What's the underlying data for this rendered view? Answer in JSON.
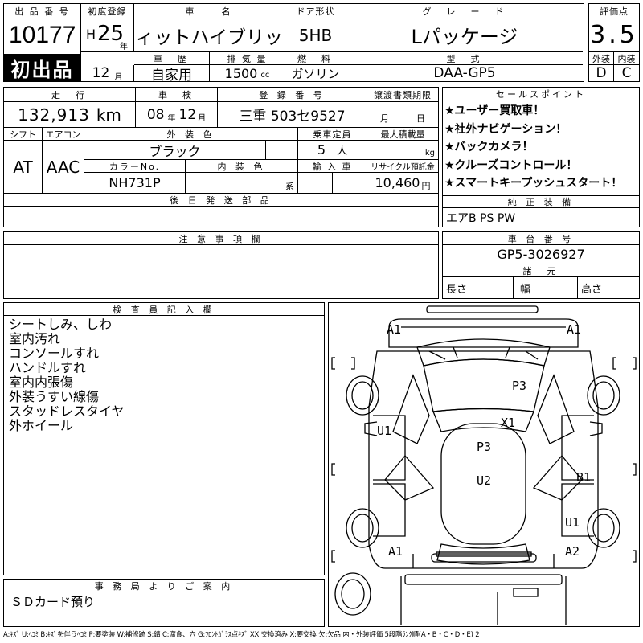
{
  "header": {
    "lot_no_label": "出 品 番 号",
    "lot_no": "10177",
    "first_listing": "初出品",
    "first_reg_label": "初度登録",
    "era": "H",
    "year": "25",
    "year_unit": "年",
    "month": "12",
    "month_unit": "月",
    "car_name_label": "車　　名",
    "car_name": "フィットハイブリッド",
    "door_label": "ドア形状",
    "door": "5HB",
    "grade_label": "グ　レ　ー　ド",
    "grade": "Lパッケージ",
    "score_label": "評価点",
    "score": "3.5",
    "history_label": "車　歴",
    "history": "自家用",
    "displacement_label": "排 気 量",
    "displacement": "1500",
    "displacement_unit": "cc",
    "fuel_label": "燃　料",
    "fuel": "ガソリン",
    "model_label": "型　式",
    "model": "DAA-GP5",
    "exterior_label": "外装",
    "exterior": "D",
    "interior_label": "内装",
    "interior": "C"
  },
  "row2": {
    "mileage_label": "走　行",
    "mileage": "132,913",
    "mileage_unit": "km",
    "inspection_label": "車　検",
    "inspection_year": "08",
    "inspection_month": "12",
    "plate_label": "登 録 番 号",
    "plate": "三重 503セ9527",
    "transfer_label": "譲渡書類期限",
    "transfer_month": "月",
    "transfer_day": "日",
    "shift_label": "シフト",
    "shift": "AT",
    "ac_label": "エアコン",
    "ac": "AAC",
    "ext_color_label": "外 装 色",
    "ext_color": "ブラック",
    "capacity_label": "乗車定員",
    "capacity": "5",
    "capacity_unit": "人",
    "load_label": "最大積載量",
    "load_unit": "kg",
    "color_no_label": "カラーNo.",
    "color_no": "NH731P",
    "int_color_label": "内 装 色",
    "int_color_unit": "系",
    "import_label": "輸 入 車",
    "recycle_label": "リサイクル預託金",
    "recycle": "10,460",
    "recycle_unit": "円",
    "later_parts_label": "後 日 発 送 部 品"
  },
  "sales": {
    "label": "セールスポイント",
    "points": [
      "★ユーザー買取車！",
      "★社外ナビゲーション！",
      "★バックカメラ！",
      "★クルーズコントロール！",
      "★スマートキープッシュスタート！"
    ],
    "equipment_label": "純 正 装 備",
    "equipment": "エアB PS PW"
  },
  "notes": {
    "label": "注 意 事 項 欄"
  },
  "chassis": {
    "label": "車 台 番 号",
    "number": "GP5-3026927",
    "specs_label": "諸　元",
    "length_label": "長さ",
    "width_label": "幅",
    "height_label": "高さ"
  },
  "inspector": {
    "label": "検 査 員 記 入 欄",
    "lines": [
      "シートしみ、しわ",
      "室内汚れ",
      "コンソールすれ",
      "ハンドルすれ",
      "室内内張傷",
      "外装うすい線傷",
      "スタッドレスタイヤ",
      "外ホイール"
    ]
  },
  "office": {
    "label": "事 務 局 よ り ご 案 内",
    "text": "ＳＤカード預り"
  },
  "diagram": {
    "marks": {
      "a1_fl": "A1",
      "a1_fr": "A1",
      "p3_hood": "P3",
      "u1_left": "U1",
      "x1": "X1",
      "p3_roof": "P3",
      "u2": "U2",
      "b1": "B1",
      "u1_right": "U1",
      "a1_rl": "A1",
      "a2": "A2"
    }
  },
  "legend": "A:ｷｽﾞ U:ﾍｺﾐ B:ｷｽﾞを伴うﾍｺﾐ P:要塗装 W:補修跡 S:錆 C:腐食、穴 G:ﾌﾛﾝﾄｶﾞﾗｽ点ｷｽﾞ XX:交換済み X:要交換 欠:欠品 内・外装評価 5段階ﾗﾝｸ順(A・B・C・D・E) 2"
}
